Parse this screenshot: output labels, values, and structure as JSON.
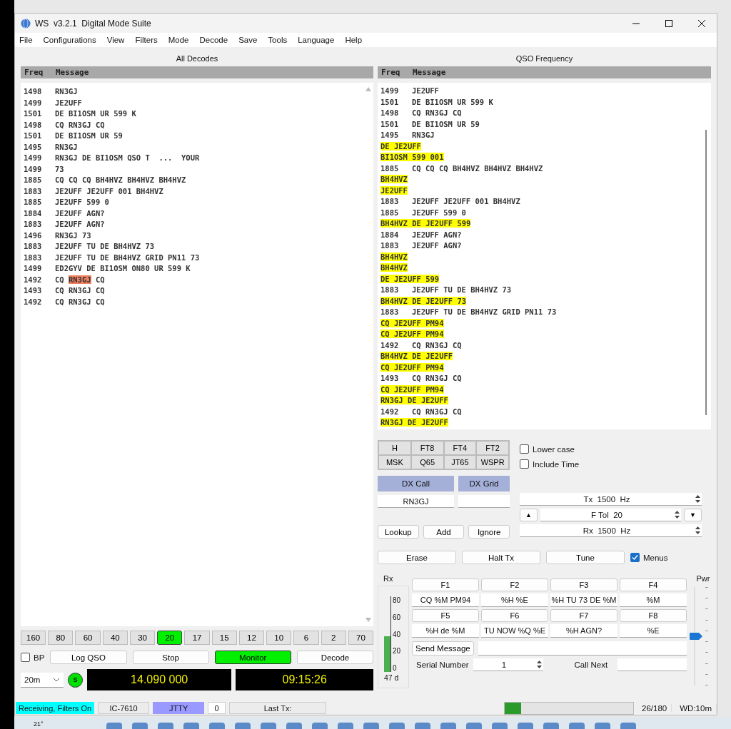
{
  "window": {
    "title": "WS  v3.2.1  Digital Mode Suite"
  },
  "menu": [
    "File",
    "Configurations",
    "View",
    "Filters",
    "Mode",
    "Decode",
    "Save",
    "Tools",
    "Language",
    "Help"
  ],
  "all_decodes": {
    "title": "All Decodes",
    "columns": [
      "Freq",
      "Message"
    ],
    "rows": [
      {
        "freq": "1498",
        "message": "RN3GJ"
      },
      {
        "freq": "1499",
        "message": "JE2UFF"
      },
      {
        "freq": "1501",
        "message": "DE BI1OSM UR 599 K"
      },
      {
        "freq": "1498",
        "message": "CQ RN3GJ CQ"
      },
      {
        "freq": "1501",
        "message": "DE BI1OSM UR 59"
      },
      {
        "freq": "1495",
        "message": "RN3GJ"
      },
      {
        "freq": "1499",
        "message": "RN3GJ DE BI1OSM QSO T  ...  YOUR"
      },
      {
        "freq": "1499",
        "message": "73"
      },
      {
        "freq": "1885",
        "message": "CQ CQ CQ BH4HVZ BH4HVZ BH4HVZ"
      },
      {
        "freq": "1883",
        "message": "JE2UFF JE2UFF 001 BH4HVZ"
      },
      {
        "freq": "1885",
        "message": "JE2UFF 599 0"
      },
      {
        "freq": "1884",
        "message": "JE2UFF AGN?"
      },
      {
        "freq": "1883",
        "message": "JE2UFF AGN?"
      },
      {
        "freq": "1496",
        "message": "RN3GJ 73"
      },
      {
        "freq": "1883",
        "message": "JE2UFF TU DE BH4HVZ 73"
      },
      {
        "freq": "1883",
        "message": "JE2UFF TU DE BH4HVZ GRID PN11 73"
      },
      {
        "freq": "1499",
        "message": "ED2GYV DE BI1OSM ON80 UR 599 K"
      },
      {
        "freq": "1492",
        "segments": [
          {
            "text": "CQ ",
            "flagged": false
          },
          {
            "text": "RN3GJ",
            "flagged": true
          },
          {
            "text": " CQ",
            "flagged": false
          }
        ]
      },
      {
        "freq": "1493",
        "message": "CQ RN3GJ CQ"
      },
      {
        "freq": "1492",
        "message": "CQ RN3GJ CQ"
      }
    ]
  },
  "qso_frequency": {
    "title": "QSO Frequency",
    "columns": [
      "Freq",
      "Message"
    ],
    "rows": [
      {
        "kind": "rx",
        "freq": "1499",
        "message": "JE2UFF"
      },
      {
        "kind": "rx",
        "freq": "1501",
        "message": "DE BI1OSM UR 599 K"
      },
      {
        "kind": "rx",
        "freq": "1498",
        "message": "CQ RN3GJ CQ"
      },
      {
        "kind": "rx",
        "freq": "1501",
        "message": "DE BI1OSM UR 59"
      },
      {
        "kind": "rx",
        "freq": "1495",
        "message": "RN3GJ"
      },
      {
        "kind": "tx",
        "message": "DE JE2UFF"
      },
      {
        "kind": "tx",
        "message": "BI1OSM 599 001"
      },
      {
        "kind": "rx",
        "freq": "1885",
        "message": "CQ CQ CQ BH4HVZ BH4HVZ BH4HVZ"
      },
      {
        "kind": "tx",
        "message": "BH4HVZ"
      },
      {
        "kind": "tx",
        "message": "JE2UFF"
      },
      {
        "kind": "rx",
        "freq": "1883",
        "message": "JE2UFF JE2UFF 001 BH4HVZ"
      },
      {
        "kind": "rx",
        "freq": "1885",
        "message": "JE2UFF 599 0"
      },
      {
        "kind": "tx",
        "message": "BH4HVZ DE JE2UFF 599"
      },
      {
        "kind": "rx",
        "freq": "1884",
        "message": "JE2UFF AGN?"
      },
      {
        "kind": "rx",
        "freq": "1883",
        "message": "JE2UFF AGN?"
      },
      {
        "kind": "tx",
        "message": "BH4HVZ"
      },
      {
        "kind": "tx",
        "message": "BH4HVZ"
      },
      {
        "kind": "tx",
        "message": "DE JE2UFF 599"
      },
      {
        "kind": "rx",
        "freq": "1883",
        "message": "JE2UFF TU DE BH4HVZ 73"
      },
      {
        "kind": "tx",
        "message": "BH4HVZ DE JE2UFF 73"
      },
      {
        "kind": "rx",
        "freq": "1883",
        "message": "JE2UFF TU DE BH4HVZ GRID PN11 73"
      },
      {
        "kind": "tx",
        "message": "CQ JE2UFF PM94"
      },
      {
        "kind": "tx",
        "message": "CQ JE2UFF PM94"
      },
      {
        "kind": "rx",
        "freq": "1492",
        "message": "CQ RN3GJ CQ"
      },
      {
        "kind": "tx",
        "message": "BH4HVZ DE JE2UFF"
      },
      {
        "kind": "tx",
        "message": "CQ JE2UFF PM94"
      },
      {
        "kind": "rx",
        "freq": "1493",
        "message": "CQ RN3GJ CQ"
      },
      {
        "kind": "tx",
        "message": "CQ JE2UFF PM94"
      },
      {
        "kind": "tx",
        "message": "RN3GJ DE JE2UFF"
      },
      {
        "kind": "rx",
        "freq": "1492",
        "message": "CQ RN3GJ CQ"
      },
      {
        "kind": "tx",
        "message": "RN3GJ DE JE2UFF"
      }
    ]
  },
  "modes": [
    "H",
    "FT8",
    "FT4",
    "FT2",
    "MSK",
    "Q65",
    "JT65",
    "WSPR"
  ],
  "options": [
    {
      "label": "Lower case",
      "checked": false
    },
    {
      "label": "Include Time",
      "checked": false
    }
  ],
  "dx": {
    "call_label": "DX Call",
    "grid_label": "DX Grid",
    "call": "RN3GJ"
  },
  "tx_freq": "Tx  1500  Hz",
  "up": "▲",
  "f_tol": "F Tol  20",
  "down": "▼",
  "rx_freq": "Rx  1500  Hz",
  "lookup_buttons": [
    "Lookup",
    "Add",
    "Ignore"
  ],
  "action_buttons": [
    "Erase",
    "Halt Tx",
    "Tune"
  ],
  "menus": {
    "label": "Menus",
    "checked": true
  },
  "rx_meter": {
    "title": "Rx",
    "ticks": [
      "80",
      "60",
      "40",
      "20",
      "0"
    ],
    "level": 0.47,
    "reading": "47 d"
  },
  "macros": [
    {
      "key": "F1",
      "text": "CQ %M PM94"
    },
    {
      "key": "F2",
      "text": "%H %E"
    },
    {
      "key": "F3",
      "text": "%H TU 73 DE %M"
    },
    {
      "key": "F4",
      "text": "%M"
    },
    {
      "key": "F5",
      "text": "%H de %M"
    },
    {
      "key": "F6",
      "text": "TU NOW %Q %E"
    },
    {
      "key": "F7",
      "text": "%H AGN?"
    },
    {
      "key": "F8",
      "text": "%E"
    }
  ],
  "send_message": "Send Message",
  "serial_label": "Serial Number",
  "serial": "1",
  "call_next": "Call Next",
  "power": {
    "title": "Pwr",
    "level": 0.5
  },
  "bands": [
    {
      "label": "160",
      "selected": false
    },
    {
      "label": "80",
      "selected": false
    },
    {
      "label": "60",
      "selected": false
    },
    {
      "label": "40",
      "selected": false
    },
    {
      "label": "30",
      "selected": false
    },
    {
      "label": "20",
      "selected": true
    },
    {
      "label": "17",
      "selected": false
    },
    {
      "label": "15",
      "selected": false
    },
    {
      "label": "12",
      "selected": false
    },
    {
      "label": "10",
      "selected": false
    },
    {
      "label": "6",
      "selected": false
    },
    {
      "label": "2",
      "selected": false
    },
    {
      "label": "70",
      "selected": false
    }
  ],
  "bp": {
    "label": "BP",
    "checked": false
  },
  "controls": [
    {
      "label": "Log QSO",
      "on": false
    },
    {
      "label": "Stop",
      "on": false
    },
    {
      "label": "Monitor",
      "on": true
    },
    {
      "label": "Decode",
      "on": false
    }
  ],
  "band_select": "20m",
  "s_badge": "S",
  "frequency": "14.090 000",
  "clock": "09:15:26",
  "status_bar": {
    "state": "Receiving, Filters On",
    "rig": "IC-7610",
    "mode": "JTTY",
    "count": "0",
    "last_tx": "Last Tx:",
    "progress": {
      "level": 0.13
    },
    "progress_text": "26/180",
    "wd": "WD:10m"
  },
  "taskbar": {
    "weather": "21°"
  }
}
